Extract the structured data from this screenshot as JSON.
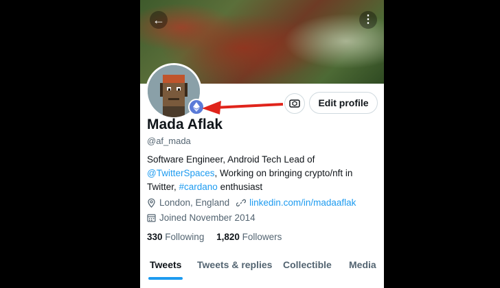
{
  "header": {
    "back_icon": "arrow-left-icon",
    "more_icon": "kebab-vertical-icon"
  },
  "profile": {
    "name": "Mada Aflak",
    "handle": "@af_mada",
    "bio_part1": "Software Engineer, Android Tech Lead of ",
    "bio_link1": "@TwitterSpaces",
    "bio_part2": ", Working on bringing crypto/nft in Twitter, ",
    "bio_link2": "#cardano",
    "bio_part3": " enthusiast",
    "location": "London, England",
    "website": "linkedin.com/in/madaaflak",
    "joined": "Joined November 2014",
    "following_count": "330",
    "following_label": "Following",
    "followers_count": "1,820",
    "followers_label": "Followers"
  },
  "actions": {
    "edit_profile": "Edit profile"
  },
  "tabs": [
    {
      "label": "Tweets"
    },
    {
      "label": "Tweets & replies"
    },
    {
      "label": "Collectible"
    },
    {
      "label": "Media"
    }
  ],
  "colors": {
    "link": "#1d9bf0",
    "annotation_arrow": "#e0241b",
    "eth_badge": "#5b7bd8"
  }
}
